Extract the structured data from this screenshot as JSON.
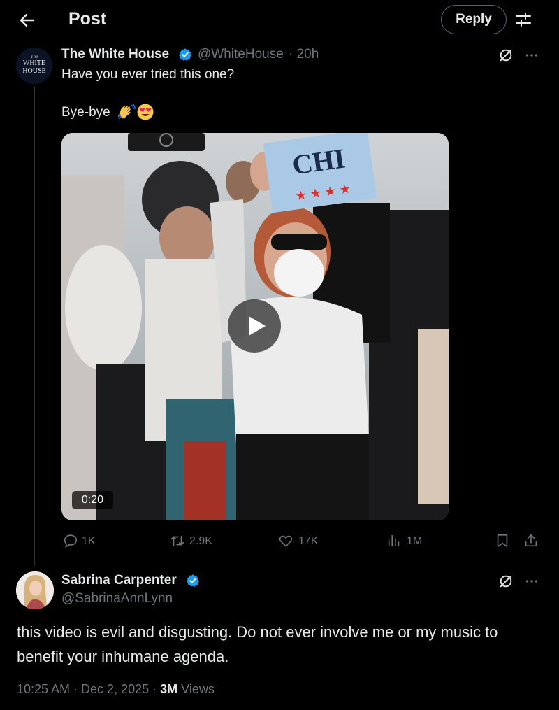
{
  "header": {
    "title": "Post",
    "reply_button": "Reply"
  },
  "post": {
    "author": {
      "name": "The White House",
      "handle": "@WhiteHouse",
      "time": "· 20h",
      "avatar_line1": "The",
      "avatar_line2": "WHITE",
      "avatar_line3": "HOUSE"
    },
    "text_line1": "Have you ever tried this one?",
    "text_line2": "Bye-bye",
    "emoji": [
      "waving-hand",
      "heart-eyes-face"
    ],
    "video": {
      "duration": "0:20",
      "sign_text": "CHI"
    },
    "actions": {
      "replies": "1K",
      "reposts": "2.9K",
      "likes": "17K",
      "views": "1M"
    }
  },
  "reply": {
    "author": {
      "name": "Sabrina Carpenter",
      "handle": "@SabrinaAnnLynn"
    },
    "text_line1": "this video is evil and disgusting. Do not ever involve me or my music to",
    "text_line2": "benefit your inhumane agenda.",
    "timestamp": "10:25 AM · Dec 2, 2025 · ",
    "views_count": "3M",
    "views_label": " Views"
  },
  "colors": {
    "background": "#000000",
    "text": "#e7e9ea",
    "secondary": "#71767b",
    "verified": "#1d9bf0",
    "border": "#536471"
  }
}
